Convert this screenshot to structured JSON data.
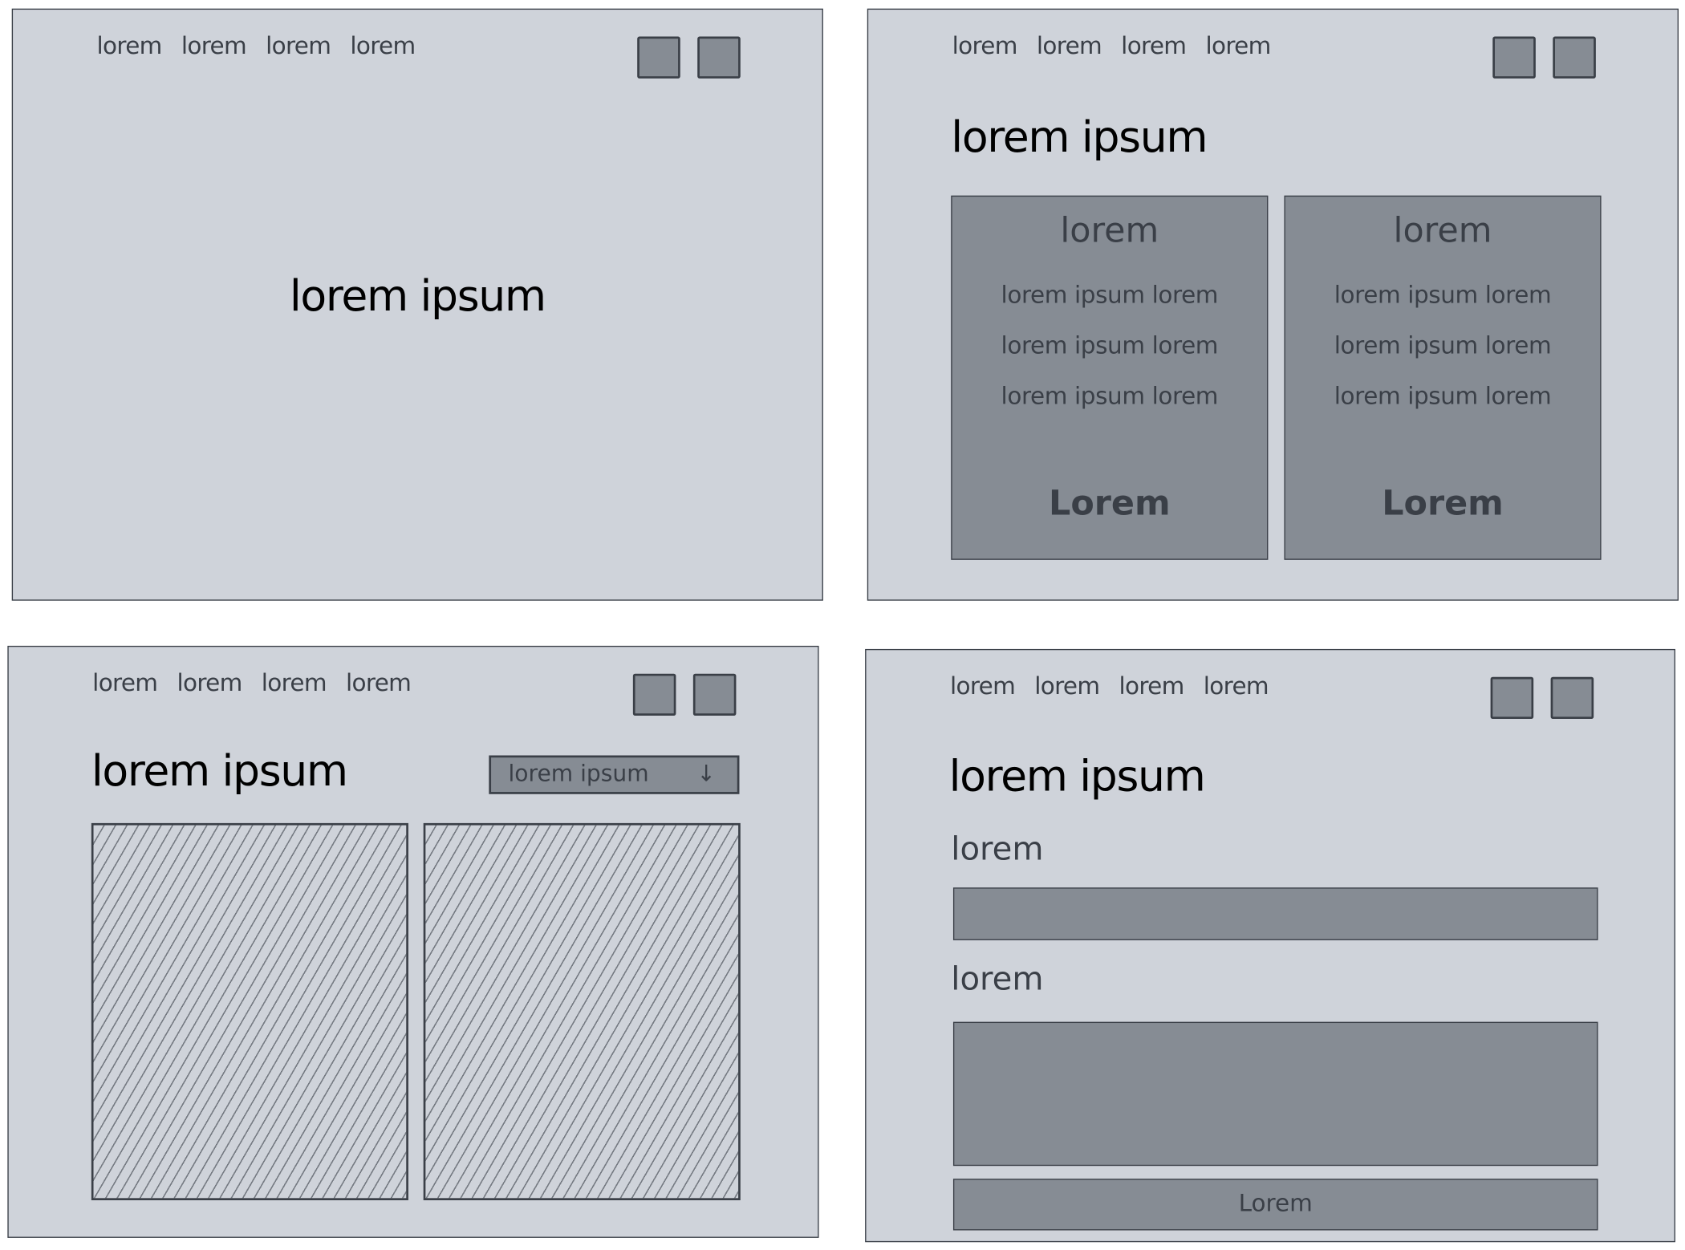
{
  "colors": {
    "panel_bg": "#cfd3da",
    "fill": "#868c94",
    "stroke": "#3a3f47",
    "title": "#000000"
  },
  "panels": [
    {
      "nav": [
        "lorem",
        "lorem",
        "lorem",
        "lorem"
      ],
      "icons": [
        "square-button-icon",
        "square-button-icon"
      ],
      "title": "lorem ipsum"
    },
    {
      "nav": [
        "lorem",
        "lorem",
        "lorem",
        "lorem"
      ],
      "title": "lorem ipsum",
      "cards": [
        {
          "title": "lorem",
          "lines": [
            "lorem ipsum lorem",
            "lorem ipsum lorem",
            "lorem ipsum lorem"
          ],
          "button": "Lorem"
        },
        {
          "title": "lorem",
          "lines": [
            "lorem ipsum lorem",
            "lorem ipsum lorem",
            "lorem ipsum lorem"
          ],
          "button": "Lorem"
        }
      ]
    },
    {
      "nav": [
        "lorem",
        "lorem",
        "lorem",
        "lorem"
      ],
      "title": "lorem ipsum",
      "dropdown": {
        "value": "lorem ipsum",
        "icon": "arrow-down-icon",
        "arrow": "↓"
      }
    },
    {
      "nav": [
        "lorem",
        "lorem",
        "lorem",
        "lorem"
      ],
      "title": "lorem ipsum",
      "label1": "lorem",
      "label2": "lorem",
      "submit": "Lorem"
    }
  ]
}
